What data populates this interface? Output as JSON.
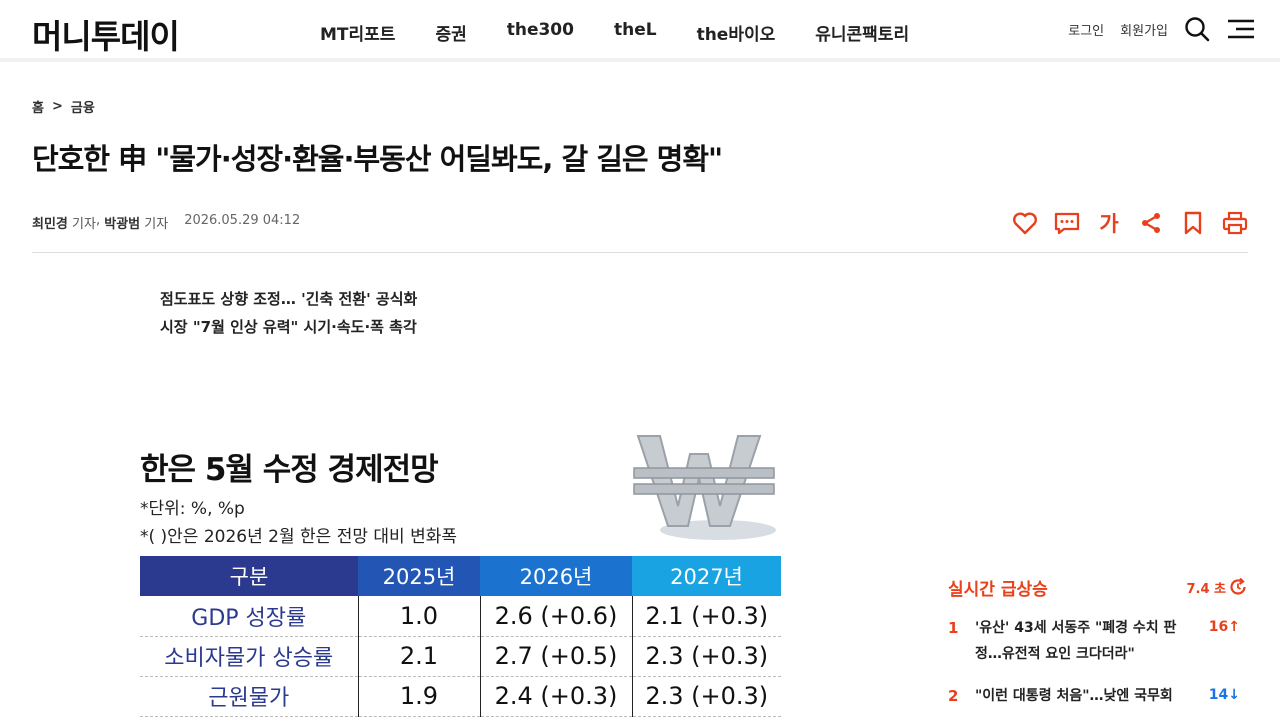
{
  "header": {
    "logo": "머니투데이",
    "nav": [
      "MT리포트",
      "증권",
      "the300",
      "theL",
      "the바이오",
      "유니콘팩토리"
    ],
    "login": "로그인",
    "signup": "회원가입"
  },
  "article": {
    "breadcrumb": {
      "home": "홈",
      "separator": ">",
      "section": "금융"
    },
    "title": "단호한 申 \"물가·성장·환율·부동산 어딜봐도, 갈 길은 명확\"",
    "reporters": [
      {
        "name": "최민경",
        "role": "기자"
      },
      {
        "name": "박광범",
        "role": "기자"
      }
    ],
    "reporter_separator": ",",
    "date": "2026.05.29 04:12",
    "tools": {
      "font_size_label": "가"
    },
    "subheads": [
      "점도표도 상향 조정… '긴축 전환' 공식화",
      "시장 \"7월 인상 유력\" 시기·속도·폭 촉각"
    ]
  },
  "infographic": {
    "title": "한은 5월 수정 경제전망",
    "notes": [
      "*단위: %, %p",
      "*(  )안은 2026년 2월 한은 전망 대비 변화폭"
    ],
    "columns": [
      "구분",
      "2025년",
      "2026년",
      "2027년"
    ],
    "rows": [
      {
        "label": "GDP 성장률",
        "values": [
          "1.0",
          "2.6 (+0.6)",
          "2.1 (+0.3)"
        ]
      },
      {
        "label": "소비자물가 상승률",
        "values": [
          "2.1",
          "2.7 (+0.5)",
          "2.3 (+0.3)"
        ]
      },
      {
        "label": "근원물가",
        "values": [
          "1.9",
          "2.4 (+0.3)",
          "2.3 (+0.3)"
        ]
      }
    ]
  },
  "sidebar": {
    "title": "실시간 급상승",
    "timer": "7.4 초",
    "items": [
      {
        "rank": "1",
        "text": "'유산' 43세 서동주 \"폐경 수치 판정…유전적 요인 크다더라\"",
        "change": "16↑",
        "direction": "up"
      },
      {
        "rank": "2",
        "text": "\"이런 대통령 처음\"…낮엔 국무회",
        "change": "14↓",
        "direction": "down"
      }
    ]
  },
  "colors": {
    "accent": "#e8401c",
    "up": "#e8401c",
    "down": "#1a73e8",
    "table_header": "#2b3a8f"
  }
}
